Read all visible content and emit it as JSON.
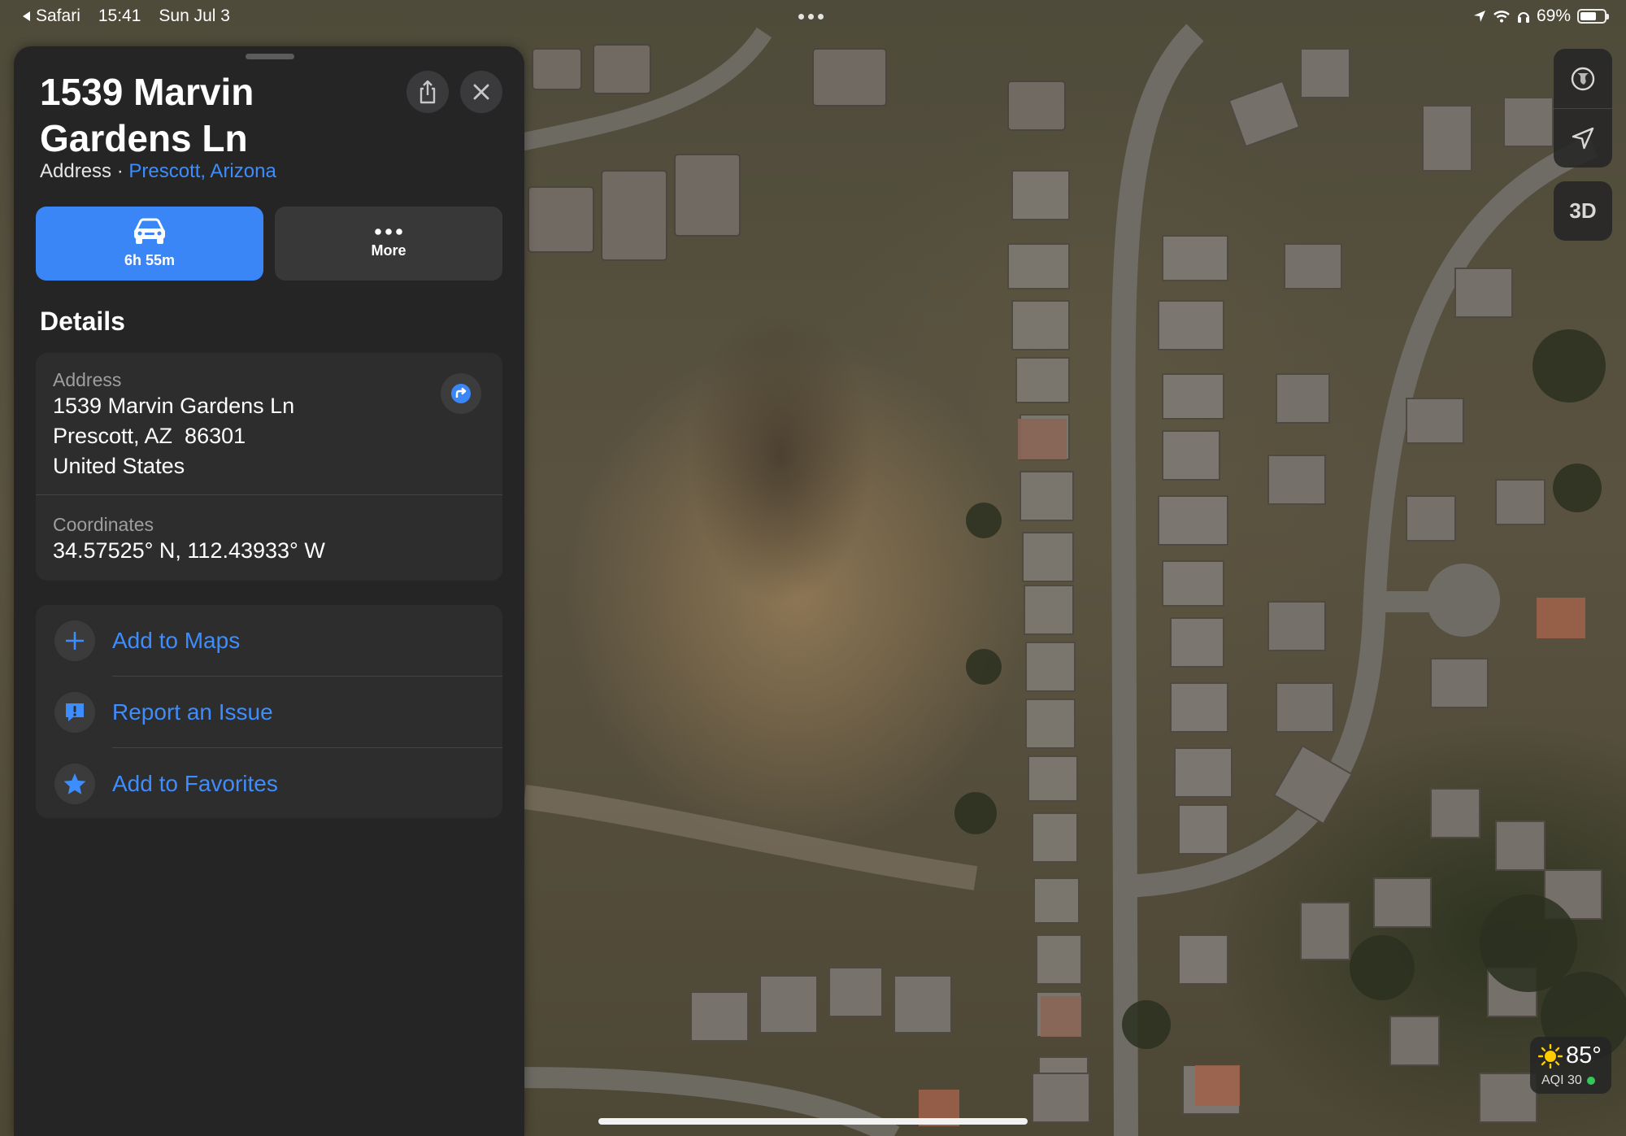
{
  "status_bar": {
    "back_app": "Safari",
    "time": "15:41",
    "date": "Sun Jul 3",
    "battery": "69%",
    "battery_level": 0.69
  },
  "place": {
    "title": "1539 Marvin Gardens Ln",
    "type": "Address",
    "separator": "·",
    "locality": "Prescott, Arizona"
  },
  "actions": {
    "drive_label": "6h 55m",
    "more_label": "More"
  },
  "details": {
    "heading": "Details",
    "address_label": "Address",
    "address_line1": "1539 Marvin Gardens Ln",
    "address_line2": "Prescott, AZ  86301",
    "address_line3": "United States",
    "coordinates_label": "Coordinates",
    "coordinates_value": "34.57525° N, 112.43933° W"
  },
  "list_actions": [
    {
      "label": "Add to Maps",
      "icon": "plus-icon"
    },
    {
      "label": "Report an Issue",
      "icon": "report-icon"
    },
    {
      "label": "Add to Favorites",
      "icon": "star-icon"
    }
  ],
  "map_controls": {
    "view_3d_label": "3D"
  },
  "weather": {
    "temperature": "85°",
    "aqi": "AQI 30",
    "aqi_color": "#34c759"
  },
  "colors": {
    "accent": "#3a86f7",
    "link": "#3d8dff",
    "panel_bg": "#252525"
  }
}
